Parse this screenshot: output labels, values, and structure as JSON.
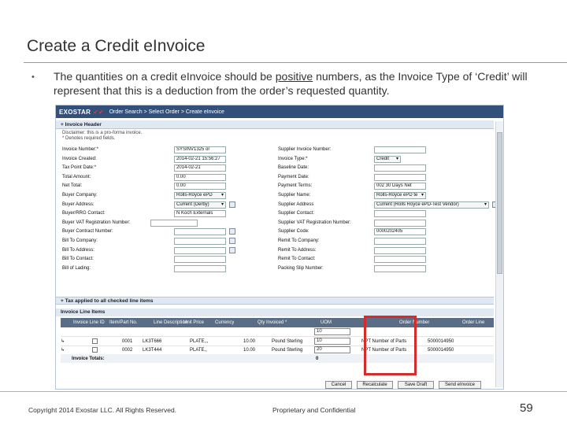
{
  "slide": {
    "title": "Create a Credit eInvoice",
    "bullet_before": "The quantities on a credit eInvoice should be ",
    "bullet_underlined": "positive",
    "bullet_after": " numbers, as the Invoice Type of ‘Credit’ will represent that this is a deduction from the order’s requested quantity."
  },
  "app": {
    "logo": "EXOSTAR",
    "logo_mark": "✔✔",
    "breadcrumb": "Order Search > Select Order > Create eInvoice",
    "invoice_header_label": "+ Invoice Header",
    "note_line1": "Disclaimer: this is a pro-forma invoice.",
    "note_line2": "* Denotes required fields.",
    "left_fields": [
      {
        "label": "Invoice Number:*",
        "value": "SYSINV1325 or"
      },
      {
        "label": "Invoice Created:",
        "value": "2014-02-21 15:56:27"
      },
      {
        "label": "Tax Point Date:*",
        "value": "2014-02-21"
      },
      {
        "label": "Total Amount:",
        "value": "0.00"
      },
      {
        "label": "Net Total:",
        "value": "0.00"
      },
      {
        "label": "Buyer Company:",
        "value": "Rolls-Royce ePD"
      },
      {
        "label": "Buyer Address:",
        "value": "Current (Derby)"
      },
      {
        "label": "Buyer/RRG Contact:",
        "value": "N Koch Externals"
      },
      {
        "label": "Buyer VAT Registration Number:",
        "value": ""
      },
      {
        "label": "Buyer Contract Number:",
        "value": ""
      },
      {
        "label": "Bill To Company:",
        "value": ""
      },
      {
        "label": "Bill To Address:",
        "value": ""
      },
      {
        "label": "Bill To Contact:",
        "value": ""
      },
      {
        "label": "Bill of Lading:",
        "value": ""
      }
    ],
    "right_fields": [
      {
        "label": "Supplier Invoice Number:",
        "value": ""
      },
      {
        "label": "Invoice Type:*",
        "value": "Credit"
      },
      {
        "label": "Baseline Date:",
        "value": ""
      },
      {
        "label": "Payment Date:",
        "value": ""
      },
      {
        "label": "Payment Terms:",
        "value": "002 30 Days Net"
      },
      {
        "label": "Supplier Name:",
        "value": "Rolls-Royce ePD te"
      },
      {
        "label": "Supplier Address",
        "value": "Current (Rolls Royce ePD-Test Vendor)"
      },
      {
        "label": "Supplier Contact:",
        "value": ""
      },
      {
        "label": "Supplier VAT Registration Number:",
        "value": ""
      },
      {
        "label": "Supplier Code:",
        "value": "0000202405"
      },
      {
        "label": "Remit To Company:",
        "value": ""
      },
      {
        "label": "Remit To Address:",
        "value": ""
      },
      {
        "label": "Remit To Contact:",
        "value": ""
      },
      {
        "label": "Packing Slip Number:",
        "value": ""
      }
    ],
    "tax_bar": "+ Tax applied to all checked line items",
    "lines_header": "Invoice Line Items",
    "columns": [
      "Invoice Line ID",
      "Item/Part No.",
      "Line Description",
      "Unit Price",
      "Currency",
      "Qty Invoiced *",
      "UOM",
      "Order Number",
      "Order Line"
    ],
    "qty_filter_value": "10",
    "rows": [
      {
        "line_id": "0001",
        "item": "LK3T666",
        "desc": "PLATE,,,",
        "price": "10.00",
        "currency": "Pound Sterling",
        "qty": "10",
        "uom": "NPT Number of Parts",
        "order": "5000014950"
      },
      {
        "line_id": "0002",
        "item": "LK3T444",
        "desc": "PLATE,,",
        "price": "10.00",
        "currency": "Pound Sterling",
        "qty": "20",
        "uom": "NPT Number of Parts",
        "order": "5000014950"
      }
    ],
    "invoice_totals_label": "Invoice Totals:",
    "invoice_totals_value": "0",
    "buttons": [
      "Cancel",
      "Recalculate",
      "Save Draft",
      "Send eInvoice"
    ]
  },
  "footer": {
    "copyright": "Copyright 2014 Exostar LLC. All Rights Reserved.",
    "confidential": "Proprietary and Confidential",
    "page_number": "59"
  }
}
